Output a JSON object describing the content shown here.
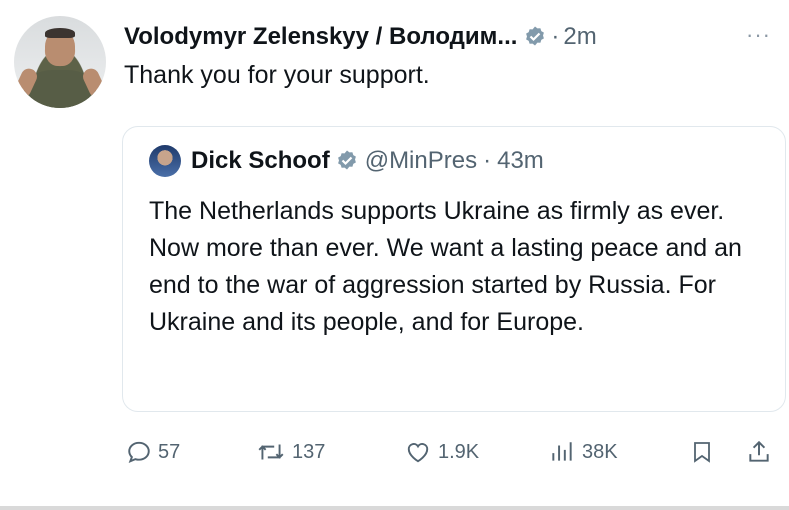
{
  "tweet": {
    "author_name": "Volodymyr Zelenskyy / Володим...",
    "separator": "·",
    "time": "2m",
    "more": "···",
    "text": "Thank you for your support."
  },
  "quote": {
    "author_name": "Dick Schoof",
    "handle": "@MinPres",
    "separator": "·",
    "time": "43m",
    "text": "The Netherlands supports Ukraine as firmly as ever. Now more than ever. We want a lasting peace and an end to the war of aggression started by Russia. For Ukraine and its people, and for Europe."
  },
  "actions": {
    "replies": "57",
    "reposts": "137",
    "likes": "1.9K",
    "views": "38K"
  },
  "colors": {
    "verified_badge": "#829aab",
    "muted_text": "#536471",
    "border": "#e1e8ed"
  },
  "icons": [
    "reply-icon",
    "repost-icon",
    "like-icon",
    "views-icon",
    "bookmark-icon",
    "share-icon",
    "verified-badge-icon"
  ]
}
